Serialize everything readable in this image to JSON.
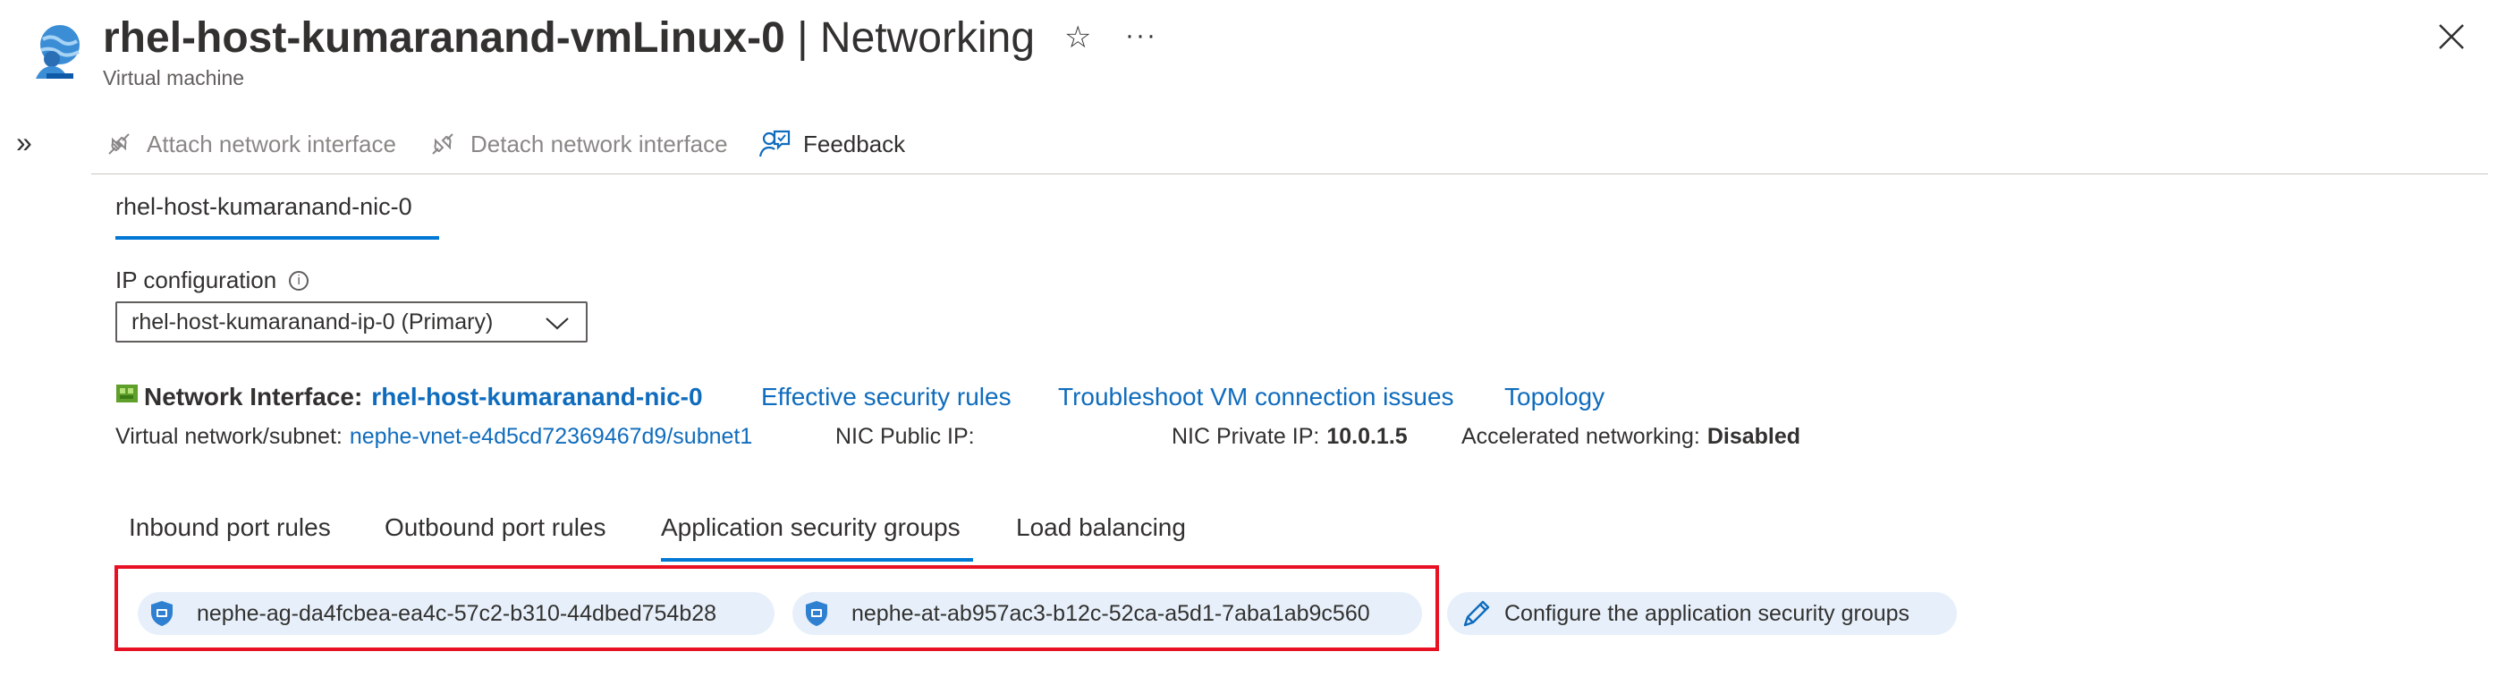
{
  "header": {
    "title_main": "rhel-host-kumaranand-vmLinux-0",
    "title_separator": " | ",
    "title_section": "Networking",
    "subtitle": "Virtual machine",
    "star_glyph": "☆",
    "more_glyph": "···",
    "collapse_glyph": "»"
  },
  "toolbar": {
    "attach_label": "Attach network interface",
    "detach_label": "Detach network interface",
    "feedback_label": "Feedback"
  },
  "nic_tab": {
    "label": "rhel-host-kumaranand-nic-0"
  },
  "ip_configuration": {
    "label": "IP configuration",
    "info_glyph": "i",
    "selected": "rhel-host-kumaranand-ip-0 (Primary)"
  },
  "network_interface": {
    "label": "Network Interface:",
    "name": "rhel-host-kumaranand-nic-0",
    "effective_rules_link": "Effective security rules",
    "troubleshoot_link": "Troubleshoot VM connection issues",
    "topology_link": "Topology"
  },
  "details": {
    "vnet_label": "Virtual network/subnet:",
    "vnet_value": "nephe-vnet-e4d5cd72369467d9/subnet1",
    "public_ip_label": "NIC Public IP:",
    "public_ip_value": "",
    "private_ip_label": "NIC Private IP:",
    "private_ip_value": "10.0.1.5",
    "accel_label": "Accelerated networking:",
    "accel_value": "Disabled"
  },
  "rule_tabs": [
    {
      "label": "Inbound port rules",
      "active": false
    },
    {
      "label": "Outbound port rules",
      "active": false
    },
    {
      "label": "Application security groups",
      "active": true
    },
    {
      "label": "Load balancing",
      "active": false
    }
  ],
  "asg_chips": [
    {
      "name": "nephe-ag-da4fcbea-ea4c-57c2-b310-44dbed754b28"
    },
    {
      "name": "nephe-at-ab957ac3-b12c-52ca-a5d1-7aba1ab9c560"
    }
  ],
  "configure_asg_label": "Configure the application security groups",
  "colors": {
    "link": "#0f6cbd",
    "accent": "#0078d4",
    "highlight_box": "#e81123",
    "chip_bg": "#e7f0fa"
  }
}
